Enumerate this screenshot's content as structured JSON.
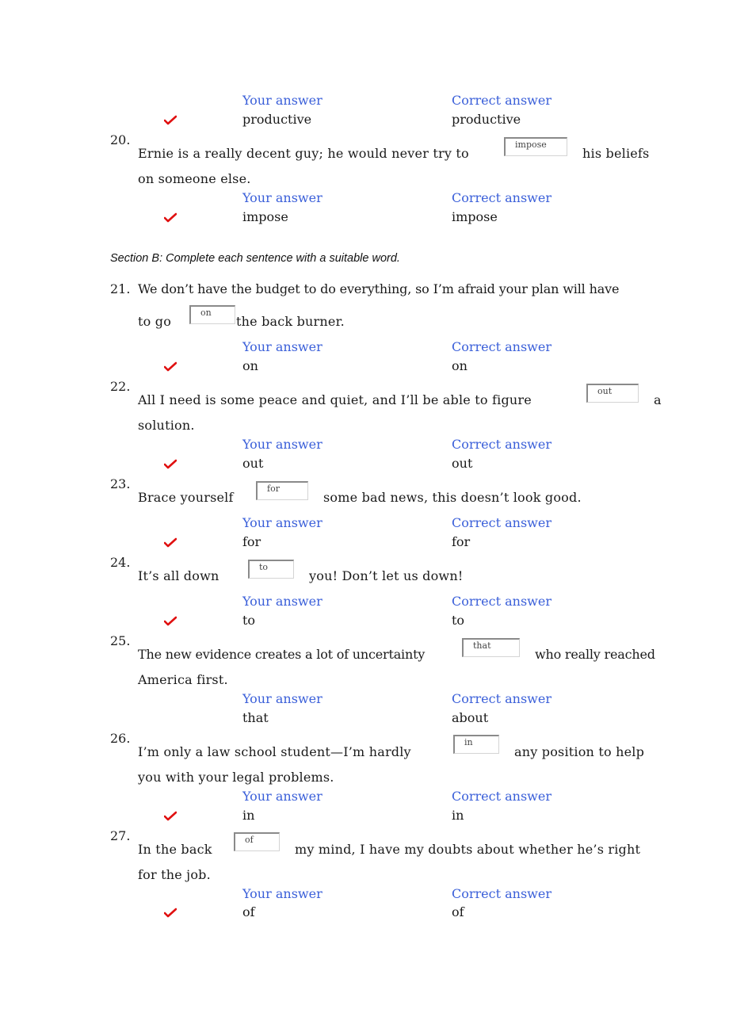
{
  "headers": {
    "your_answer": "Your answer",
    "correct_answer": "Correct answer"
  },
  "section_b": "Section B: Complete each sentence with a suitable word.",
  "q19": {
    "your": "productive",
    "correct": "productive",
    "correct_flag": true
  },
  "q20": {
    "num": "20.",
    "line1a": "Ernie is a really decent guy; he would never try to",
    "input": "impose",
    "line1b": "his beliefs",
    "line2": "on someone else.",
    "your": "impose",
    "correct": "impose",
    "correct_flag": true
  },
  "q21": {
    "num": "21.",
    "line1": "We don’t have the budget to do everything, so I’m afraid your plan will have",
    "line2a": "to go",
    "input": "on",
    "line2b": "the back burner.",
    "your": "on",
    "correct": "on",
    "correct_flag": true
  },
  "q22": {
    "num": "22.",
    "line1a": "All I need is some peace and quiet, and I’ll be able to figure",
    "input": "out",
    "line1b": "a",
    "line2": "solution.",
    "your": "out",
    "correct": "out",
    "correct_flag": true
  },
  "q23": {
    "num": "23.",
    "line1a": "Brace yourself",
    "input": "for",
    "line1b": "some bad news, this doesn’t look good.",
    "your": "for",
    "correct": "for",
    "correct_flag": true
  },
  "q24": {
    "num": "24.",
    "line1a": "It’s all down",
    "input": "to",
    "line1b": "you! Don’t let us down!",
    "your": "to",
    "correct": "to",
    "correct_flag": true
  },
  "q25": {
    "num": "25.",
    "line1a": "The new evidence creates a lot of uncertainty",
    "input": "that",
    "line1b": "who really reached",
    "line2": "America first.",
    "your": "that",
    "correct": "about",
    "correct_flag": false
  },
  "q26": {
    "num": "26.",
    "line1a": "I’m only a law school student—I’m hardly",
    "input": "in",
    "line1b": "any position to help",
    "line2": "you with your legal problems.",
    "your": "in",
    "correct": "in",
    "correct_flag": true
  },
  "q27": {
    "num": "27.",
    "line1a": "In the back",
    "input": "of",
    "line1b": "my mind, I have my doubts about whether he’s right",
    "line2": "for the job.",
    "your": "of",
    "correct": "of",
    "correct_flag": true
  },
  "colors": {
    "header_blue": "#3a5fd9",
    "check_red": "#e01010"
  }
}
